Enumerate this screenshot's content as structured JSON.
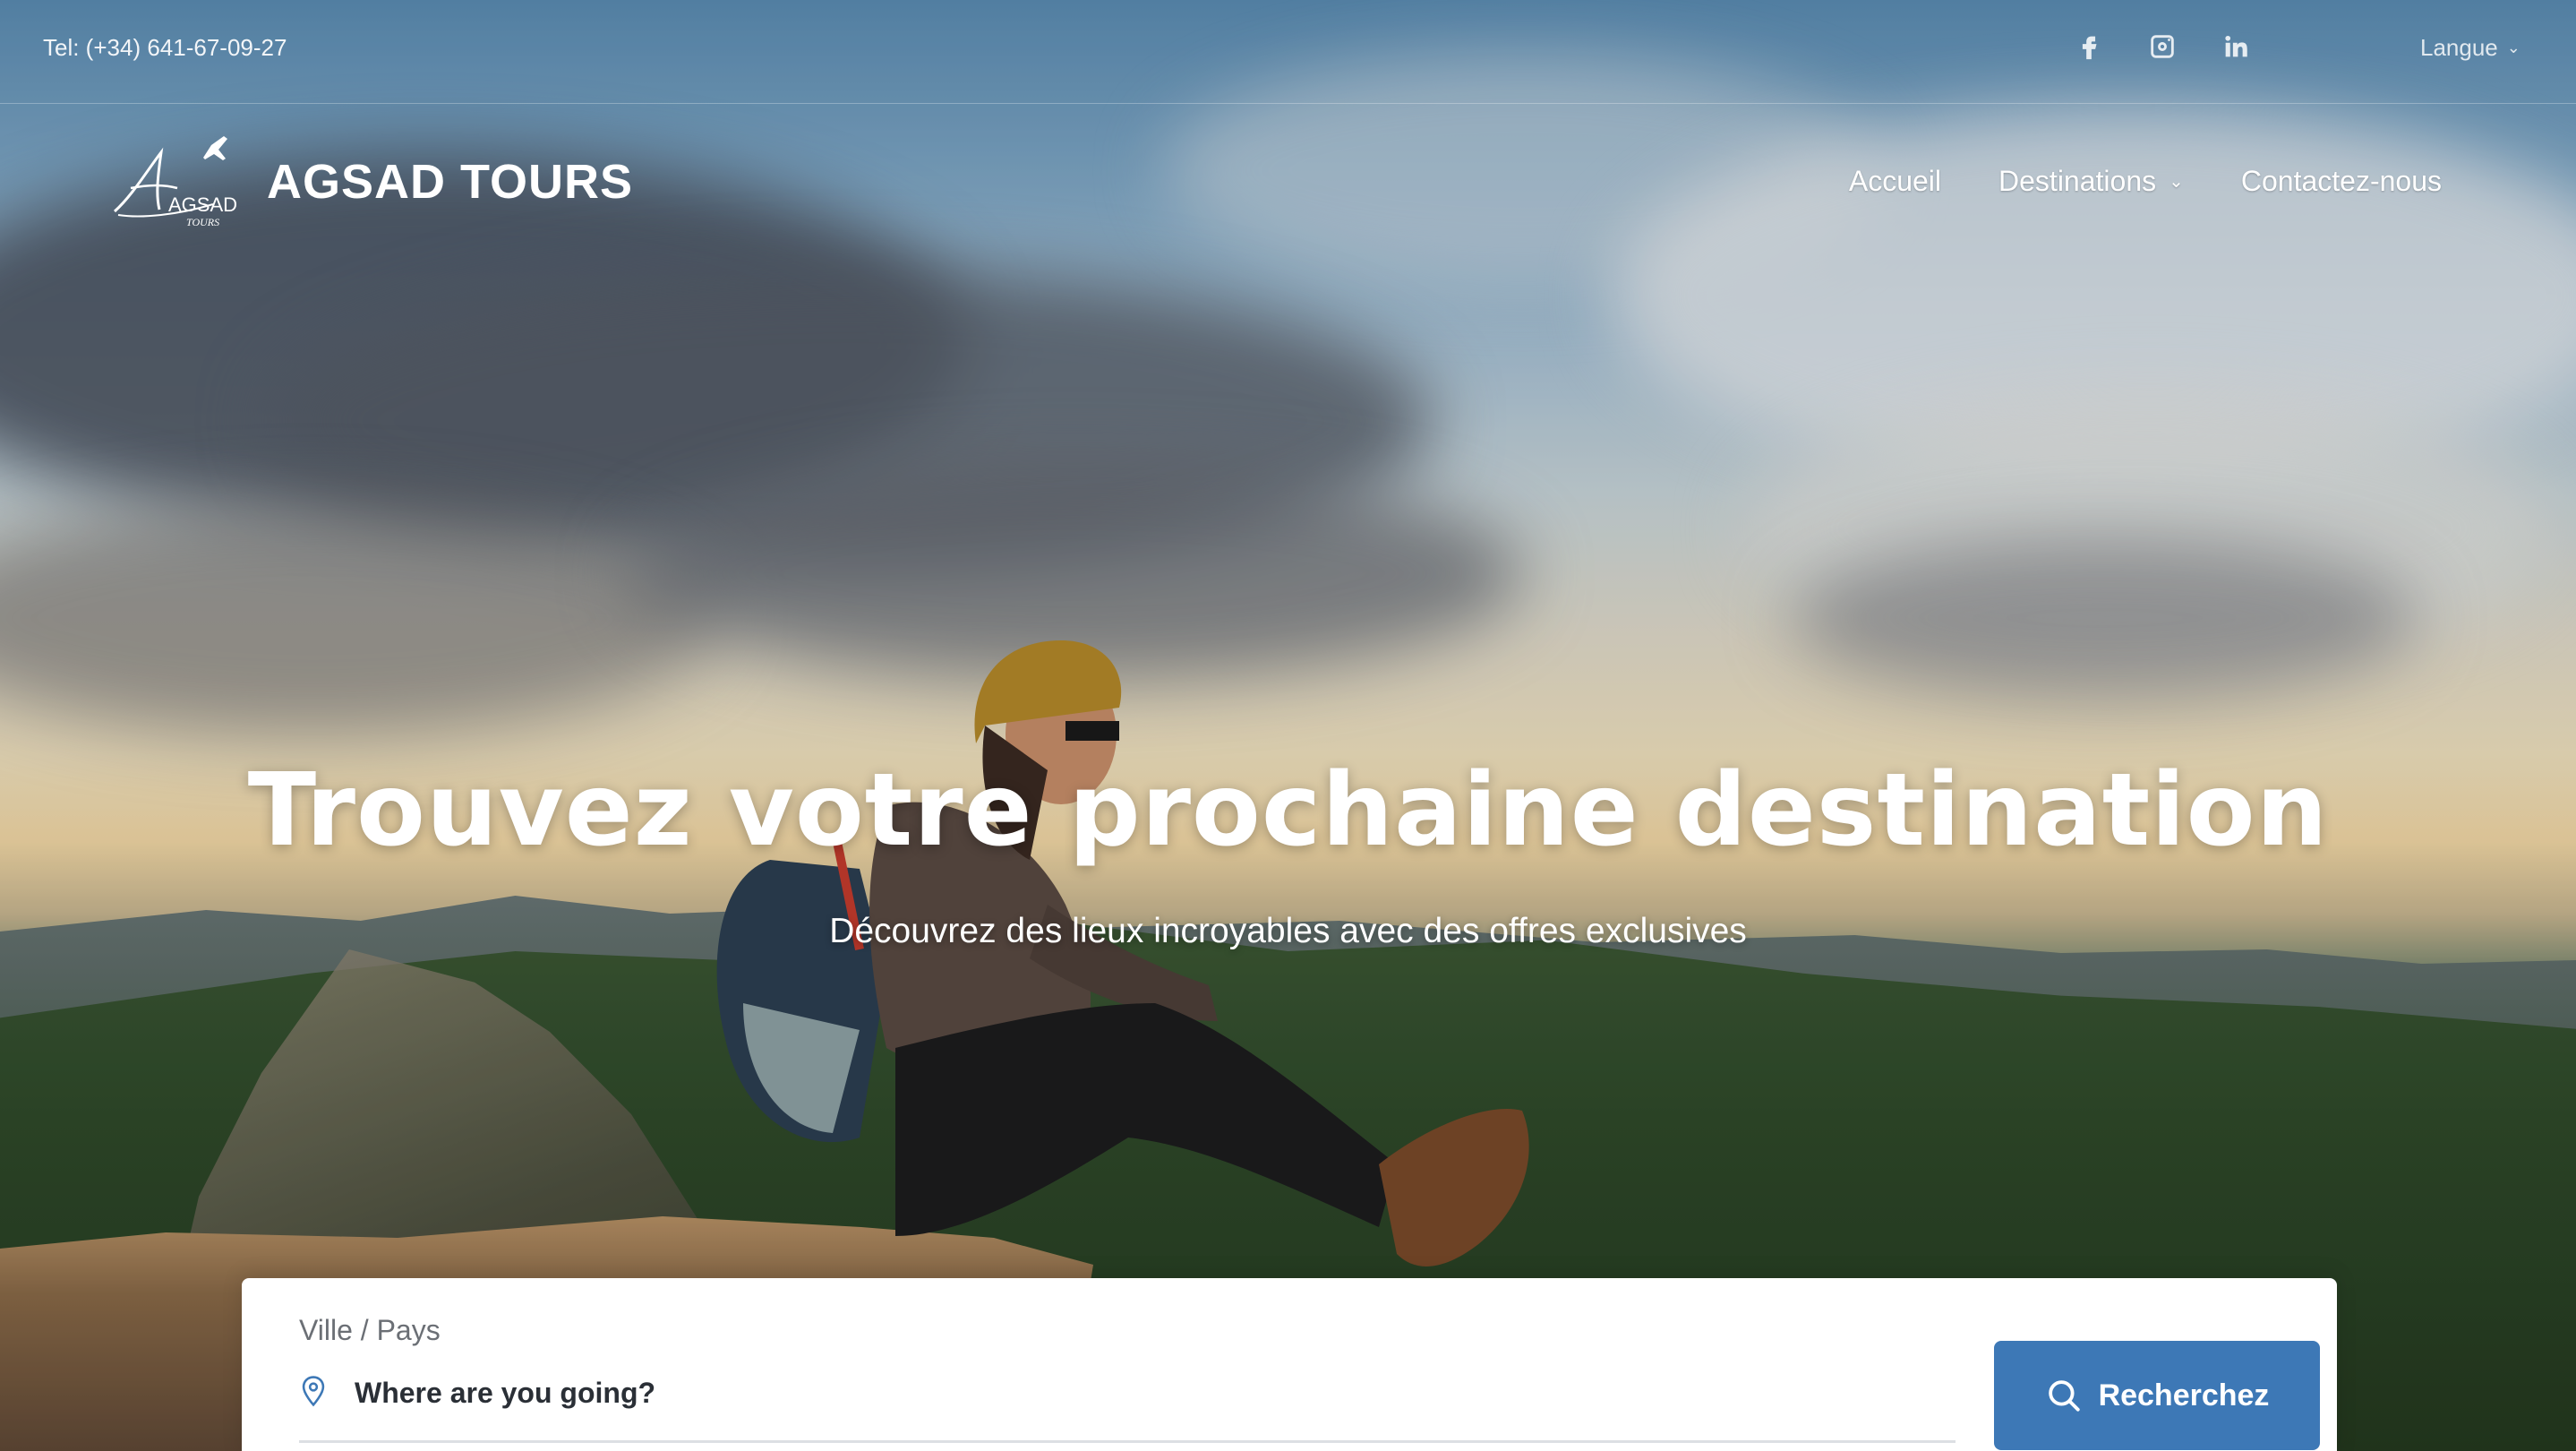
{
  "topbar": {
    "phone": "Tel: (+34) 641-67-09-27",
    "socials": [
      "facebook-icon",
      "instagram-icon",
      "linkedin-icon"
    ],
    "language_label": "Langue"
  },
  "header": {
    "logo_text": "AGSAD",
    "logo_subtext": "TOURS",
    "brand": "AGSAD TOURS",
    "nav": [
      {
        "label": "Accueil"
      },
      {
        "label": "Destinations",
        "has_dropdown": true
      },
      {
        "label": "Contactez-nous"
      }
    ]
  },
  "hero": {
    "title": "Trouvez votre prochaine destination",
    "subtitle": "Découvrez des lieux incroyables avec des offres exclusives"
  },
  "search": {
    "label": "Ville / Pays",
    "placeholder": "Where are you going?",
    "button_label": "Recherchez"
  },
  "colors": {
    "accent": "#3d78b6",
    "panel": "#ffffff",
    "text_dark": "#2a2f36"
  }
}
